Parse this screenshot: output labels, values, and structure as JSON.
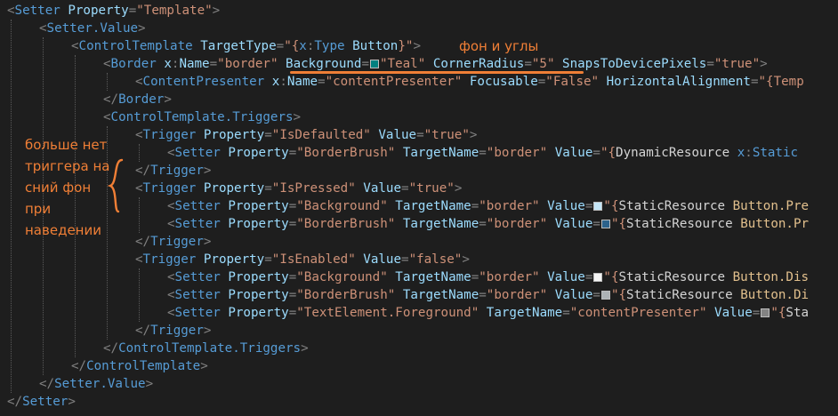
{
  "code": {
    "lines": [
      [
        [
          "p",
          "<"
        ],
        [
          "t",
          "Setter"
        ],
        [
          "k",
          " "
        ],
        [
          "a",
          "Property"
        ],
        [
          "p",
          "="
        ],
        [
          "v",
          "\"Template\""
        ],
        [
          "p",
          ">"
        ]
      ],
      [
        [
          "p",
          "<"
        ],
        [
          "t",
          "Setter.Value"
        ],
        [
          "p",
          ">"
        ]
      ],
      [
        [
          "p",
          "<"
        ],
        [
          "t",
          "ControlTemplate"
        ],
        [
          "k",
          " "
        ],
        [
          "a",
          "TargetType"
        ],
        [
          "p",
          "="
        ],
        [
          "v",
          "\"{"
        ],
        [
          "t",
          "x"
        ],
        [
          "p",
          ":"
        ],
        [
          "t",
          "Type"
        ],
        [
          "k",
          " "
        ],
        [
          "y",
          "Button"
        ],
        [
          "v",
          "}\""
        ],
        [
          "p",
          ">"
        ]
      ],
      [
        [
          "p",
          "<"
        ],
        [
          "t",
          "Border"
        ],
        [
          "k",
          " "
        ],
        [
          "a",
          "x"
        ],
        [
          "p",
          ":"
        ],
        [
          "a",
          "Name"
        ],
        [
          "p",
          "="
        ],
        [
          "v",
          "\"border\""
        ],
        [
          "k",
          " "
        ],
        [
          "a",
          "Background"
        ],
        [
          "p",
          "="
        ],
        [
          "sw",
          "#008080"
        ],
        [
          "v",
          "\"Teal\""
        ],
        [
          "k",
          " "
        ],
        [
          "a",
          "CornerRadius"
        ],
        [
          "p",
          "="
        ],
        [
          "v",
          "\"5\""
        ],
        [
          "k",
          " "
        ],
        [
          "a",
          "SnapsToDevicePixels"
        ],
        [
          "p",
          "="
        ],
        [
          "v",
          "\"true\""
        ],
        [
          "p",
          ">"
        ]
      ],
      [
        [
          "p",
          "<"
        ],
        [
          "t",
          "ContentPresenter"
        ],
        [
          "k",
          " "
        ],
        [
          "a",
          "x"
        ],
        [
          "p",
          ":"
        ],
        [
          "a",
          "Name"
        ],
        [
          "p",
          "="
        ],
        [
          "v",
          "\"contentPresenter\""
        ],
        [
          "k",
          " "
        ],
        [
          "a",
          "Focusable"
        ],
        [
          "p",
          "="
        ],
        [
          "v",
          "\"False\""
        ],
        [
          "k",
          " "
        ],
        [
          "a",
          "HorizontalAlignment"
        ],
        [
          "p",
          "="
        ],
        [
          "v",
          "\"{Temp"
        ]
      ],
      [
        [
          "p",
          "</"
        ],
        [
          "t",
          "Border"
        ],
        [
          "p",
          ">"
        ]
      ],
      [
        [
          "p",
          "<"
        ],
        [
          "t",
          "ControlTemplate.Triggers"
        ],
        [
          "p",
          ">"
        ]
      ],
      [
        [
          "p",
          "<"
        ],
        [
          "t",
          "Trigger"
        ],
        [
          "k",
          " "
        ],
        [
          "a",
          "Property"
        ],
        [
          "p",
          "="
        ],
        [
          "v",
          "\"IsDefaulted\""
        ],
        [
          "k",
          " "
        ],
        [
          "a",
          "Value"
        ],
        [
          "p",
          "="
        ],
        [
          "v",
          "\"true\""
        ],
        [
          "p",
          ">"
        ]
      ],
      [
        [
          "p",
          "<"
        ],
        [
          "t",
          "Setter"
        ],
        [
          "k",
          " "
        ],
        [
          "a",
          "Property"
        ],
        [
          "p",
          "="
        ],
        [
          "v",
          "\"BorderBrush\""
        ],
        [
          "k",
          " "
        ],
        [
          "a",
          "TargetName"
        ],
        [
          "p",
          "="
        ],
        [
          "v",
          "\"border\""
        ],
        [
          "k",
          " "
        ],
        [
          "a",
          "Value"
        ],
        [
          "p",
          "="
        ],
        [
          "v",
          "\"{"
        ],
        [
          "n",
          "DynamicResource"
        ],
        [
          "k",
          " "
        ],
        [
          "t",
          "x"
        ],
        [
          "p",
          ":"
        ],
        [
          "t",
          "Static"
        ]
      ],
      [
        [
          "p",
          "</"
        ],
        [
          "t",
          "Trigger"
        ],
        [
          "p",
          ">"
        ]
      ],
      [
        [
          "p",
          "<"
        ],
        [
          "t",
          "Trigger"
        ],
        [
          "k",
          " "
        ],
        [
          "a",
          "Property"
        ],
        [
          "p",
          "="
        ],
        [
          "v",
          "\"IsPressed\""
        ],
        [
          "k",
          " "
        ],
        [
          "a",
          "Value"
        ],
        [
          "p",
          "="
        ],
        [
          "v",
          "\"true\""
        ],
        [
          "p",
          ">"
        ]
      ],
      [
        [
          "p",
          "<"
        ],
        [
          "t",
          "Setter"
        ],
        [
          "k",
          " "
        ],
        [
          "a",
          "Property"
        ],
        [
          "p",
          "="
        ],
        [
          "v",
          "\"Background\""
        ],
        [
          "k",
          " "
        ],
        [
          "a",
          "TargetName"
        ],
        [
          "p",
          "="
        ],
        [
          "v",
          "\"border\""
        ],
        [
          "k",
          " "
        ],
        [
          "a",
          "Value"
        ],
        [
          "p",
          "="
        ],
        [
          "sw",
          "#c4e5f6"
        ],
        [
          "v",
          "\"{"
        ],
        [
          "n",
          "StaticResource"
        ],
        [
          "k",
          " "
        ],
        [
          "r",
          "Button.Pre"
        ]
      ],
      [
        [
          "p",
          "<"
        ],
        [
          "t",
          "Setter"
        ],
        [
          "k",
          " "
        ],
        [
          "a",
          "Property"
        ],
        [
          "p",
          "="
        ],
        [
          "v",
          "\"BorderBrush\""
        ],
        [
          "k",
          " "
        ],
        [
          "a",
          "TargetName"
        ],
        [
          "p",
          "="
        ],
        [
          "v",
          "\"border\""
        ],
        [
          "k",
          " "
        ],
        [
          "a",
          "Value"
        ],
        [
          "p",
          "="
        ],
        [
          "sw",
          "#2c628b"
        ],
        [
          "v",
          "\"{"
        ],
        [
          "n",
          "StaticResource"
        ],
        [
          "k",
          " "
        ],
        [
          "r",
          "Button.Pr"
        ]
      ],
      [
        [
          "p",
          "</"
        ],
        [
          "t",
          "Trigger"
        ],
        [
          "p",
          ">"
        ]
      ],
      [
        [
          "p",
          "<"
        ],
        [
          "t",
          "Trigger"
        ],
        [
          "k",
          " "
        ],
        [
          "a",
          "Property"
        ],
        [
          "p",
          "="
        ],
        [
          "v",
          "\"IsEnabled\""
        ],
        [
          "k",
          " "
        ],
        [
          "a",
          "Value"
        ],
        [
          "p",
          "="
        ],
        [
          "v",
          "\"false\""
        ],
        [
          "p",
          ">"
        ]
      ],
      [
        [
          "p",
          "<"
        ],
        [
          "t",
          "Setter"
        ],
        [
          "k",
          " "
        ],
        [
          "a",
          "Property"
        ],
        [
          "p",
          "="
        ],
        [
          "v",
          "\"Background\""
        ],
        [
          "k",
          " "
        ],
        [
          "a",
          "TargetName"
        ],
        [
          "p",
          "="
        ],
        [
          "v",
          "\"border\""
        ],
        [
          "k",
          " "
        ],
        [
          "a",
          "Value"
        ],
        [
          "p",
          "="
        ],
        [
          "sw",
          "#f4f4f4"
        ],
        [
          "v",
          "\"{"
        ],
        [
          "n",
          "StaticResource"
        ],
        [
          "k",
          " "
        ],
        [
          "r",
          "Button.Dis"
        ]
      ],
      [
        [
          "p",
          "<"
        ],
        [
          "t",
          "Setter"
        ],
        [
          "k",
          " "
        ],
        [
          "a",
          "Property"
        ],
        [
          "p",
          "="
        ],
        [
          "v",
          "\"BorderBrush\""
        ],
        [
          "k",
          " "
        ],
        [
          "a",
          "TargetName"
        ],
        [
          "p",
          "="
        ],
        [
          "v",
          "\"border\""
        ],
        [
          "k",
          " "
        ],
        [
          "a",
          "Value"
        ],
        [
          "p",
          "="
        ],
        [
          "sw",
          "#adb2b5"
        ],
        [
          "v",
          "\"{"
        ],
        [
          "n",
          "StaticResource"
        ],
        [
          "k",
          " "
        ],
        [
          "r",
          "Button.Di"
        ]
      ],
      [
        [
          "p",
          "<"
        ],
        [
          "t",
          "Setter"
        ],
        [
          "k",
          " "
        ],
        [
          "a",
          "Property"
        ],
        [
          "p",
          "="
        ],
        [
          "v",
          "\"TextElement.Foreground\""
        ],
        [
          "k",
          " "
        ],
        [
          "a",
          "TargetName"
        ],
        [
          "p",
          "="
        ],
        [
          "v",
          "\"contentPresenter\""
        ],
        [
          "k",
          " "
        ],
        [
          "a",
          "Value"
        ],
        [
          "p",
          "="
        ],
        [
          "sw",
          "#838383"
        ],
        [
          "v",
          "\"{"
        ],
        [
          "n",
          "Sta"
        ]
      ],
      [
        [
          "p",
          "</"
        ],
        [
          "t",
          "Trigger"
        ],
        [
          "p",
          ">"
        ]
      ],
      [
        [
          "p",
          "</"
        ],
        [
          "t",
          "ControlTemplate.Triggers"
        ],
        [
          "p",
          ">"
        ]
      ],
      [
        [
          "p",
          "</"
        ],
        [
          "t",
          "ControlTemplate"
        ],
        [
          "p",
          ">"
        ]
      ],
      [
        [
          "p",
          "</"
        ],
        [
          "t",
          "Setter.Value"
        ],
        [
          "p",
          ">"
        ]
      ],
      [
        [
          "p",
          "</"
        ],
        [
          "t",
          "Setter"
        ],
        [
          "p",
          ">"
        ]
      ]
    ]
  },
  "annotations": {
    "top_note": "фон и углы",
    "left_note_lines": [
      "больше нет",
      "триггера на",
      "сний фон",
      "при",
      "наведении"
    ]
  },
  "colors": {
    "background": "#1e1e1e",
    "tag": "#569cd6",
    "attribute": "#9cdcfe",
    "string": "#ce9178",
    "punctuation": "#808080",
    "resource_key": "#e2c08d",
    "annotation": "#f07f36"
  }
}
